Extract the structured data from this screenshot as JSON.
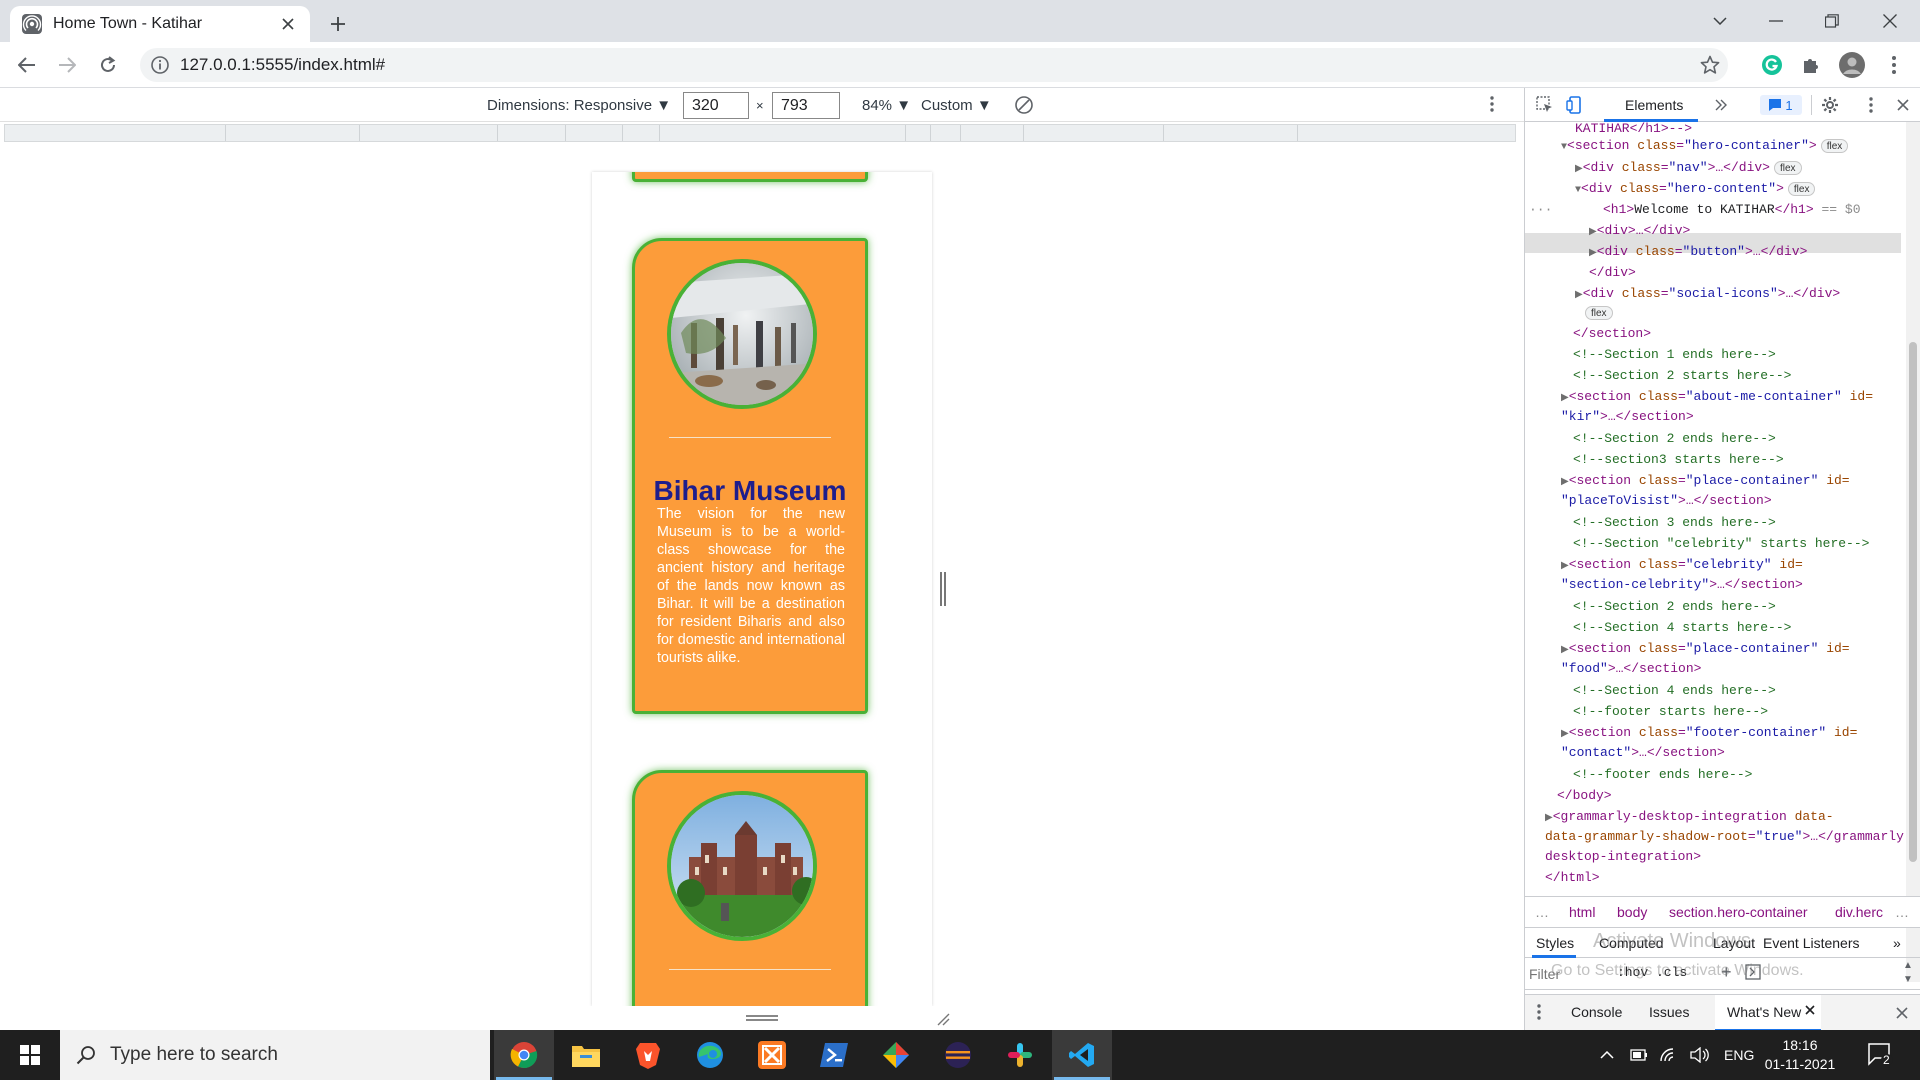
{
  "browser": {
    "tab_title": "Home Town - Katihar",
    "url": "127.0.0.1:5555/index.html#"
  },
  "device_toolbar": {
    "dimensions_label": "Dimensions: Responsive ▼",
    "width": "320",
    "times": "×",
    "height": "793",
    "zoom": "84% ▼",
    "throttle": "Custom ▼"
  },
  "page": {
    "cards": [
      {
        "title": "Bihar Museum",
        "description": "The vision for the new Museum is to be a world-class showcase for the ancient history and heritage of the lands now known as Bihar. It will be a destination for resident Biharis and also for domestic and international tourists alike."
      }
    ]
  },
  "devtools": {
    "tabs": {
      "elements": "Elements",
      "issues_count": "1"
    },
    "dom_lines": {
      "l0": "KATIHAR</h1>-->",
      "l1_tag": "<section",
      "l1_attr": "class",
      "l1_val": "\"hero-container\"",
      "l1_pill": "flex",
      "l2_val": "\"nav\"",
      "l3_val": "\"hero-content\"",
      "l4_text": "Welcome to KATIHAR",
      "l4_suffix": "== $0",
      "l5": "<div>…</div>",
      "l6_val": "\"button\"",
      "l7": "</div>",
      "l8_val": "\"social-icons\"",
      "l9": "</section>",
      "c1": "<!--Section 1 ends here-->",
      "c2": "<!--Section 2 starts here-->",
      "s2_val": "\"about-me-container\"",
      "s2_id": "\"kir\"",
      "c3": "<!--Section 2 ends here-->",
      "c4": "<!--section3 starts here-->",
      "s3_val": "\"place-container\"",
      "s3_id": "\"placeToVisist\"",
      "c5": "<!--Section 3 ends here-->",
      "c6": "<!--Section \"celebrity\" starts here-->",
      "s4_val": "\"celebrity\"",
      "s4_id": "\"section-celebrity\"",
      "c7": "<!--Section 2 ends here-->",
      "c8": "<!--Section 4 starts here-->",
      "s5_val": "\"place-container\"",
      "s5_id": "\"food\"",
      "c9": "<!--Section 4 ends here-->",
      "c10": "<!--footer starts here-->",
      "s6_val": "\"footer-container\"",
      "s6_id": "\"contact\"",
      "c11": "<!--footer ends here-->",
      "body_close": "</body>",
      "gram1": "grammarly-desktop-integration",
      "gram2": "data-grammarly-shadow-root",
      "gram3": "\"true\"",
      "html_close": "</html>"
    },
    "breadcrumbs": [
      "html",
      "body",
      "section.hero-container",
      "div.herc"
    ],
    "styles_tabs": [
      "Styles",
      "Computed",
      "Layout",
      "Event Listeners"
    ],
    "filter_placeholder": "Filter",
    "hov_cls": ":hov  .cls",
    "drawer_tabs": [
      "Console",
      "Issues",
      "What's New"
    ],
    "watermark_line1": "Activate Windows",
    "watermark_line2": "Go to Settings to activate Windows."
  },
  "taskbar": {
    "search_placeholder": "Type here to search",
    "language": "ENG",
    "time": "18:16",
    "date": "01-11-2021",
    "notification_count": "2"
  }
}
